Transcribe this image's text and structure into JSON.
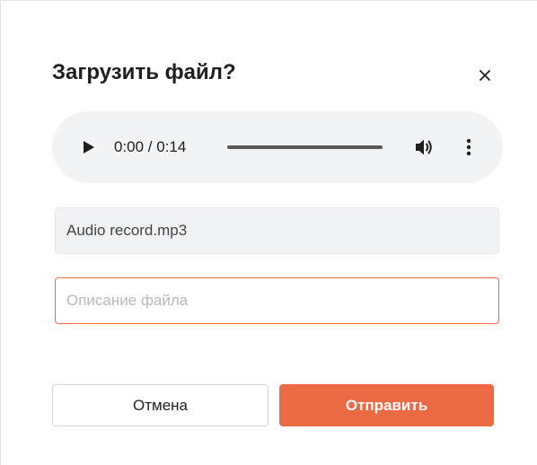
{
  "dialog": {
    "title": "Загрузить файл?",
    "close_icon": "close-icon"
  },
  "player": {
    "play_icon": "play-icon",
    "time": "0:00 / 0:14",
    "progress": 0,
    "volume_icon": "volume-icon",
    "menu_icon": "more-vertical-icon"
  },
  "file": {
    "name": "Audio record.mp3"
  },
  "description": {
    "value": "",
    "placeholder": "Описание файла"
  },
  "actions": {
    "cancel_label": "Отмена",
    "send_label": "Отправить"
  },
  "colors": {
    "accent": "#ec6a43",
    "player_bg": "#f1f3f4",
    "field_bg": "#f0f2f4"
  }
}
